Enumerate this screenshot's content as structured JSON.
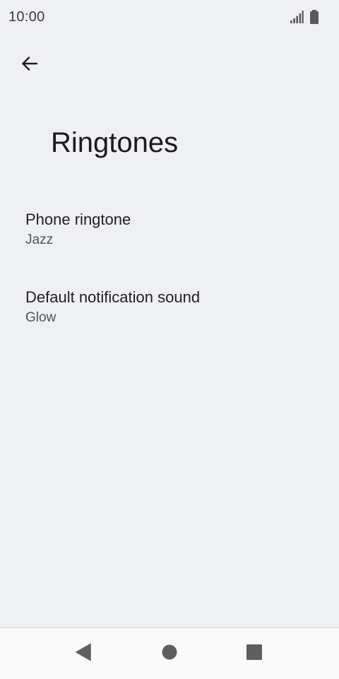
{
  "status_bar": {
    "time": "10:00",
    "icons": [
      "signal-icon",
      "battery-icon"
    ]
  },
  "header": {
    "back_icon": "back-arrow-icon",
    "title": "Ringtones"
  },
  "preferences": [
    {
      "title": "Phone ringtone",
      "summary": "Jazz"
    },
    {
      "title": "Default notification sound",
      "summary": "Glow"
    }
  ],
  "navigation": {
    "icons": [
      "back-triangle-icon",
      "home-circle-icon",
      "recents-square-icon"
    ]
  },
  "colors": {
    "background": "#eff0f3",
    "nav_background": "#fafafa",
    "nav_icon": "#5f5f5f",
    "text_primary": "#1f1f1f",
    "text_secondary": "#505357"
  }
}
